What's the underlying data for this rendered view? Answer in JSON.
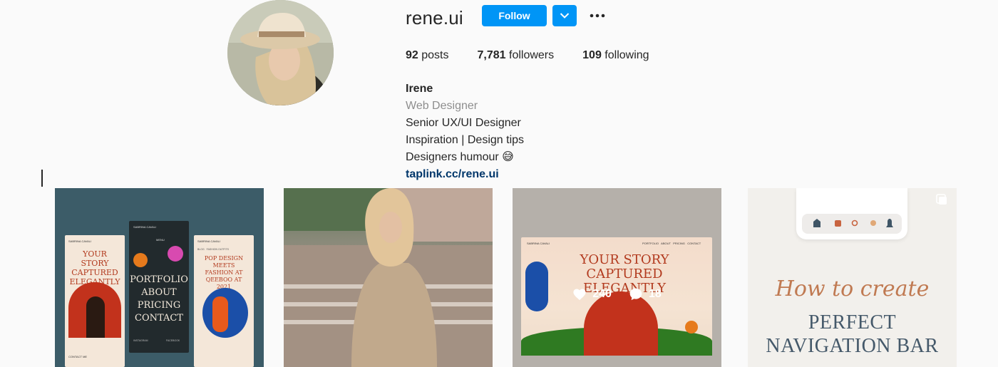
{
  "profile": {
    "username": "rene.ui",
    "follow_label": "Follow",
    "stats": {
      "posts_count": "92",
      "posts_label": "posts",
      "followers_count": "7,781",
      "followers_label": "followers",
      "following_count": "109",
      "following_label": "following"
    },
    "bio": {
      "name": "Irene",
      "category": "Web Designer",
      "line1": "Senior UX/UI Designer",
      "line2": "Inspiration | Design tips",
      "line3": "Designers humour 😅",
      "link": "taplink.cc/rene.ui"
    }
  },
  "posts": [
    {
      "card1_brand": "SABRINA CAVALI",
      "card1_headline": "YOUR STORY CAPTURED ELEGANTLY",
      "card2_brand": "SABRINA CAVALI",
      "card2_menu": "MENU",
      "card2_items": [
        "PORTFOLIO",
        "ABOUT",
        "PRICING",
        "CONTACT"
      ],
      "card2_footer_left": "INSTAGRAM",
      "card2_footer_right": "FACEBOOK",
      "card3_brand": "SABRINA CAVALI",
      "card3_tags": "BLOG   FASHION OUTFITS",
      "card3_headline": "POP DESIGN MEETS FASHION AT QEEBOO AT 2021",
      "card1_cta": "CONTACT ME"
    },
    {},
    {
      "brand": "SABRINA CAVALI",
      "nav": "PORTFOLIO   ABOUT   PRICING   CONTACT",
      "headline": "YOUR STORY CAPTURED ELEGANTLY",
      "likes": "240",
      "comments": "18"
    },
    {
      "script_title": "How to create",
      "main_title_line1": "PERFECT",
      "main_title_line2": "NAVIGATION BAR"
    }
  ],
  "colors": {
    "accent": "#0095f6",
    "link": "#00376b",
    "muted": "#8e8e8e",
    "text": "#262626"
  }
}
